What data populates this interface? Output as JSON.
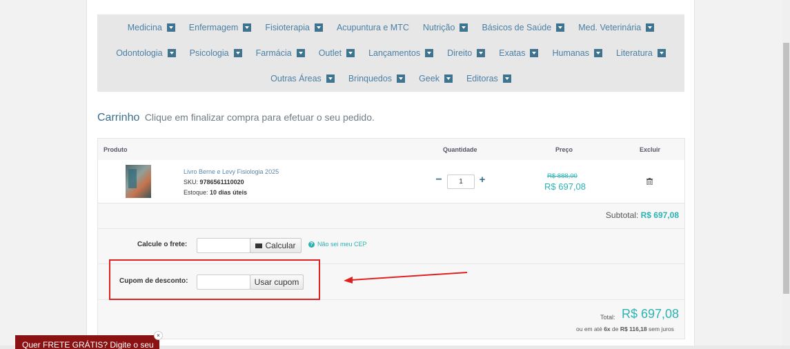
{
  "nav": {
    "row1": [
      "Medicina",
      "Enfermagem",
      "Fisioterapia",
      "Acupuntura e MTC",
      "Nutrição",
      "Básicos de Saúde",
      "Med. Veterinária"
    ],
    "row1_chev": [
      true,
      true,
      true,
      false,
      true,
      true,
      true
    ],
    "row2": [
      "Odontologia",
      "Psicologia",
      "Farmácia",
      "Outlet",
      "Lançamentos",
      "Direito",
      "Exatas",
      "Humanas",
      "Literatura"
    ],
    "row3": [
      "Outras Áreas",
      "Brinquedos",
      "Geek",
      "Editoras"
    ]
  },
  "cart": {
    "title": "Carrinho",
    "subtitle": "Clique em finalizar compra para efetuar o seu pedido."
  },
  "table": {
    "headers": {
      "product": "Produto",
      "quantity": "Quantidade",
      "price": "Preço",
      "remove": "Excluir"
    }
  },
  "product": {
    "name": "Livro Berne e Levy Fisiologia 2025",
    "sku_label": "SKU:",
    "sku": "9786561110020",
    "stock_label": "Estoque:",
    "stock": "10 dias úteis",
    "quantity": "1",
    "minus": "−",
    "plus": "+",
    "price_old": "R$ 888,00",
    "price_new": "R$ 697,08"
  },
  "subtotal": {
    "label": "Subtotal:",
    "value": "R$ 697,08"
  },
  "shipping": {
    "label": "Calcule o frete:",
    "button": "Calcular",
    "help": "Não sei meu CEP"
  },
  "coupon": {
    "label": "Cupom de desconto:",
    "button": "Usar cupom"
  },
  "total": {
    "label": "Total:",
    "value": "R$ 697,08",
    "installments_prefix": "ou em até",
    "installments_count": "6x",
    "installments_mid": "de",
    "installments_value": "R$ 116,18",
    "installments_suffix": "sem juros"
  },
  "promo": {
    "text": "Quer FRETE GRÁTIS? Digite o seu",
    "close": "×"
  },
  "colors": {
    "accent": "#2bb3b3",
    "link": "#4a7fa5",
    "annotation": "#e02020",
    "promo_bg": "#8b1212"
  }
}
